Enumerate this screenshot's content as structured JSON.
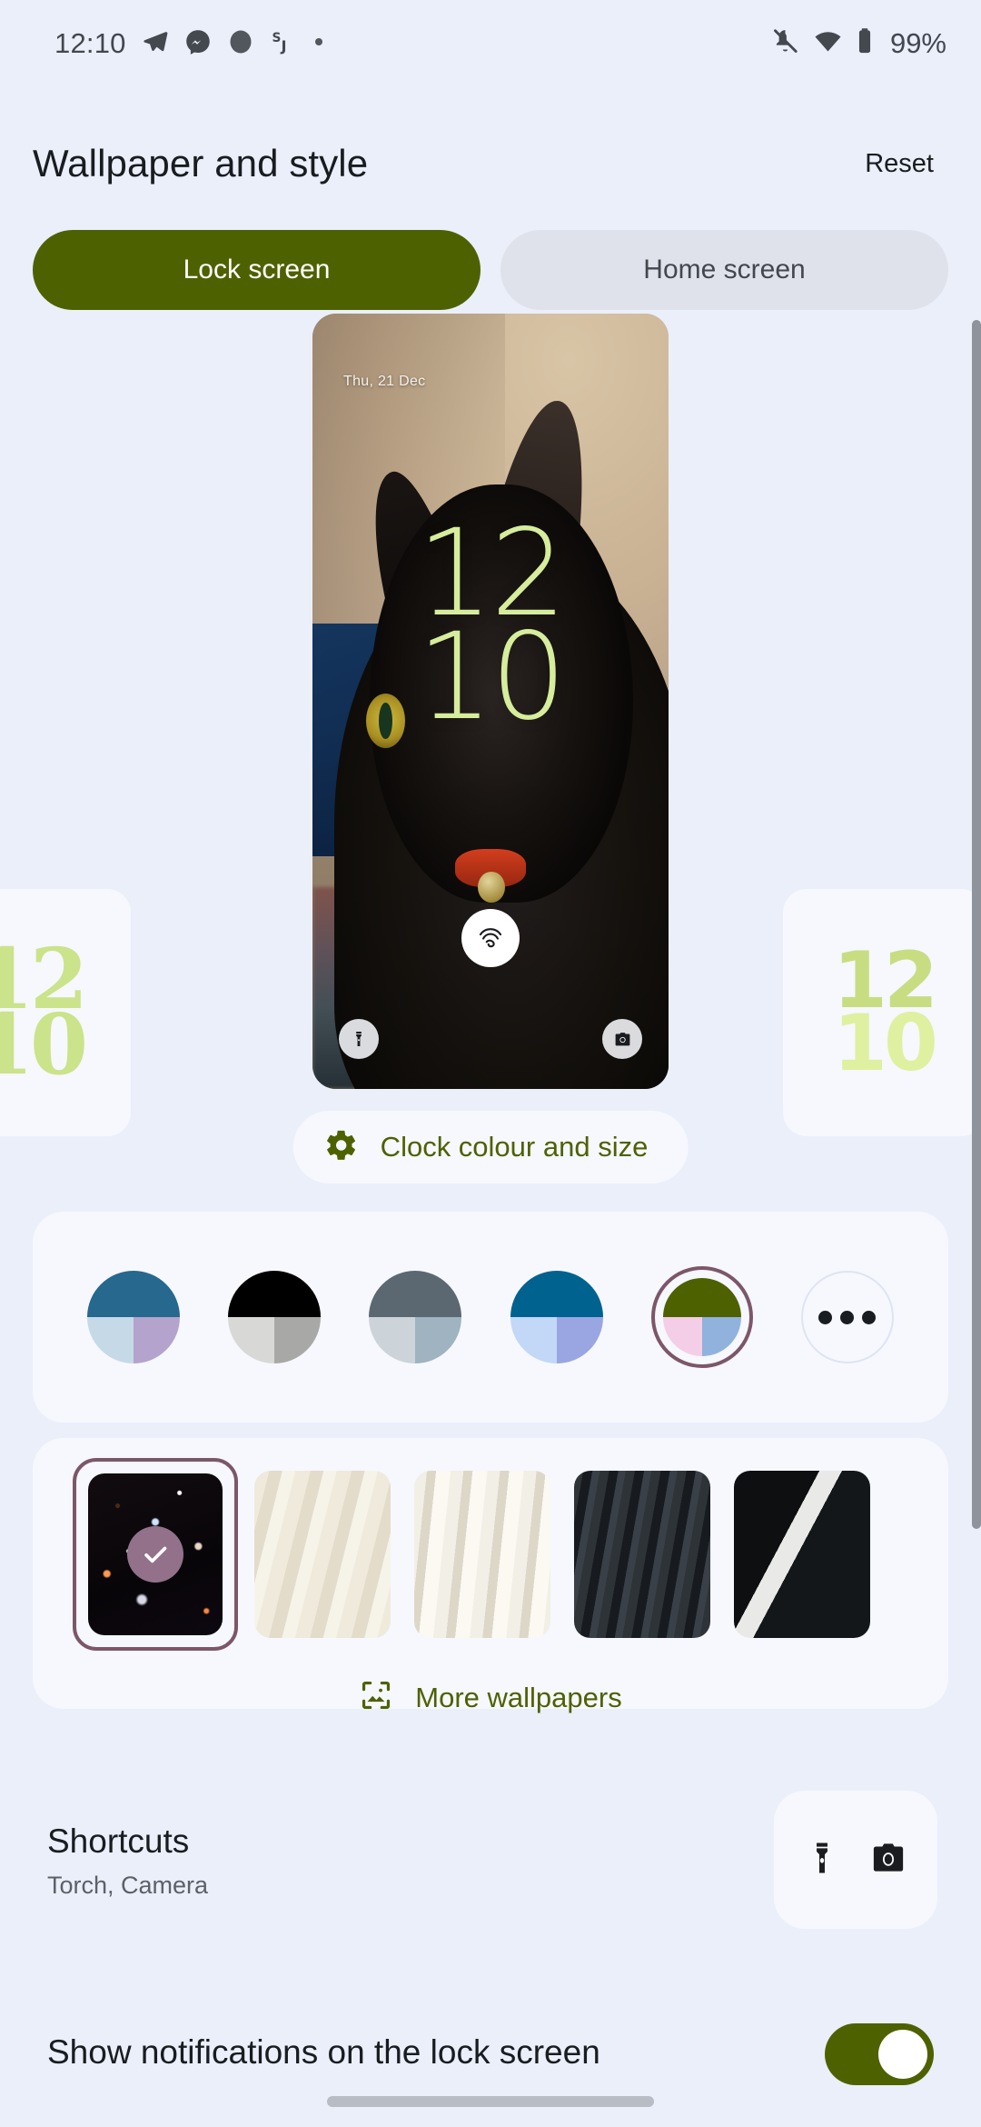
{
  "status_bar": {
    "time": "12:10",
    "battery_percent": "99%",
    "left_icons": [
      "telegram-icon",
      "messenger-icon",
      "circle-notification-icon",
      "sj-app-icon",
      "overflow-dot-icon"
    ],
    "right_icons": [
      "ringer-muted-icon",
      "wifi-icon",
      "battery-icon"
    ]
  },
  "header": {
    "title": "Wallpaper and style",
    "reset_label": "Reset"
  },
  "tabs": {
    "items": [
      {
        "label": "Lock screen",
        "selected": true
      },
      {
        "label": "Home screen",
        "selected": false
      }
    ]
  },
  "preview": {
    "date": "Thu, 21 Dec",
    "clock_hour": "12",
    "clock_minute": "10",
    "clock_colour": "#d6ed9c",
    "unlock_icon": "fingerprint-icon",
    "left_shortcut_icon": "torch-icon",
    "right_shortcut_icon": "camera-icon",
    "side_previews": [
      {
        "position": "left",
        "clock_hour": "12",
        "clock_minute": "10",
        "style": "serif"
      },
      {
        "position": "right",
        "clock_hour": "12",
        "clock_minute": "10",
        "style": "bold"
      }
    ]
  },
  "clock_settings": {
    "icon": "gear-icon",
    "label": "Clock colour and size",
    "accent": "#4e6100"
  },
  "colors": {
    "swatches": [
      {
        "name": "teal",
        "top": "#26688e",
        "bottom_left": "#c6d9e6",
        "bottom_right": "#b3a3cd",
        "selected": false
      },
      {
        "name": "black",
        "top": "#000000",
        "bottom_left": "#d8d8d6",
        "bottom_right": "#a8a8a6",
        "selected": false
      },
      {
        "name": "slate",
        "top": "#5b6871",
        "bottom_left": "#ccd4da",
        "bottom_right": "#9fb3c0",
        "selected": false
      },
      {
        "name": "blue",
        "top": "#00628f",
        "bottom_left": "#c3d7f7",
        "bottom_right": "#9aa6e2",
        "selected": false
      },
      {
        "name": "olive",
        "top": "#4e6100",
        "bottom_left": "#f4cee6",
        "bottom_right": "#90b2dd",
        "selected": true
      }
    ],
    "more_label": "more-colors-icon",
    "selection_ring": "#7c5768"
  },
  "wallpapers": {
    "thumbnails": [
      {
        "name": "galaxy-wallpaper",
        "selected": true
      },
      {
        "name": "cream-feathers-wallpaper",
        "selected": false
      },
      {
        "name": "white-feathers-wallpaper",
        "selected": false
      },
      {
        "name": "dark-feathers-wallpaper",
        "selected": false
      },
      {
        "name": "black-white-feathers-wallpaper",
        "selected": false
      }
    ],
    "more_icon": "image-icon",
    "more_label": "More wallpapers"
  },
  "shortcuts": {
    "title": "Shortcuts",
    "subtitle": "Torch, Camera",
    "icons": [
      "torch-icon",
      "camera-icon"
    ]
  },
  "notifications": {
    "label": "Show notifications on the lock screen",
    "enabled": true,
    "accent": "#4e6100"
  }
}
